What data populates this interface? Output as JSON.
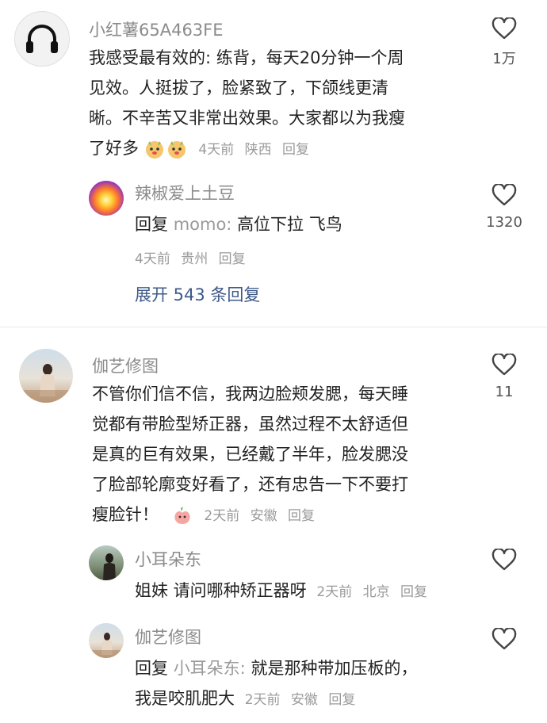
{
  "comments": [
    {
      "user": "小红薯65A463FE",
      "text_lines": [
        "我感受最有效的: 练背，每天20分钟一个周",
        "见效。人挺拔了，脸紧致了，下颌线更清",
        "晰。不辛苦又非常出效果。大家都以为我瘦",
        "了好多"
      ],
      "time": "4天前",
      "location": "陕西",
      "reply_label": "回复",
      "likes": "1万",
      "avatar_icon": "headphones-icon",
      "replies": [
        {
          "user": "辣椒爱上土豆",
          "prefix": "回复",
          "reply_to": "momo:",
          "text": "高位下拉 飞鸟",
          "time": "4天前",
          "location": "贵州",
          "reply_label": "回复",
          "likes": "1320"
        }
      ],
      "expand_label": "展开 543 条回复"
    },
    {
      "user": "伽艺修图",
      "text_lines": [
        "不管你们信不信，我两边脸颊发腮，每天睡",
        "觉都有带脸型矫正器，虽然过程不太舒适但",
        "是真的巨有效果，已经戴了半年，脸发腮没",
        "了脸部轮廓变好看了，还有忠告一下不要打",
        "瘦脸针！"
      ],
      "time": "2天前",
      "location": "安徽",
      "reply_label": "回复",
      "likes": "11",
      "replies": [
        {
          "user": "小耳朵东",
          "text": "姐妹 请问哪种矫正器呀",
          "time": "2天前",
          "location": "北京",
          "reply_label": "回复"
        },
        {
          "user": "伽艺修图",
          "prefix": "回复",
          "reply_to": "小耳朵东:",
          "text": "就是那种带加压板的，",
          "text2": "我是咬肌肥大",
          "time": "2天前",
          "location": "安徽",
          "reply_label": "回复"
        }
      ]
    }
  ],
  "colors": {
    "link": "#3e5a8a",
    "meta": "#9a9a9a",
    "text": "#222222"
  }
}
